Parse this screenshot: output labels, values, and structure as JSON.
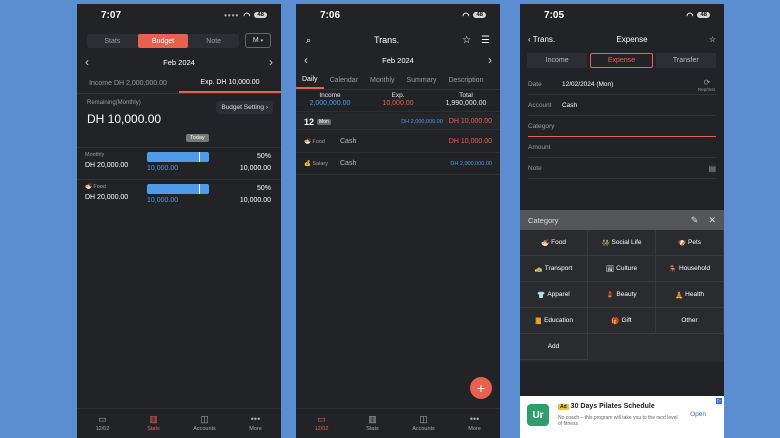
{
  "status": {
    "time_1": "7:07",
    "time_2": "7:06",
    "time_3": "7:05",
    "battery": "48"
  },
  "stats_screen": {
    "tabs": [
      "Stats",
      "Budget",
      "Note"
    ],
    "period_button": "M",
    "month": "Feb 2024",
    "income_tab": "Income DH 2,000,000.00",
    "expense_tab": "Exp. DH 10,000.00",
    "remaining_label": "Remaining(Monthly)",
    "remaining_amount": "DH 10,000.00",
    "budget_setting": "Budget Setting",
    "today_label": "Today",
    "budgets": [
      {
        "label": "Monthly",
        "amount": "DH 20,000.00",
        "percent": "50%",
        "percent_value": 0.5,
        "spent": "10,000.00",
        "total": "10,000.00"
      },
      {
        "label": "Food",
        "amount": "DH 20,000.00",
        "percent": "50%",
        "percent_value": 0.5,
        "spent": "10,000.00",
        "total": "10,000.00"
      }
    ],
    "nav": [
      {
        "label": "12/02",
        "icon": "calendar-icon"
      },
      {
        "label": "Stats",
        "icon": "stats-icon"
      },
      {
        "label": "Accounts",
        "icon": "accounts-icon"
      },
      {
        "label": "More",
        "icon": "more-icon"
      }
    ]
  },
  "trans_screen": {
    "title": "Trans.",
    "month": "Feb 2024",
    "tabs": [
      "Daily",
      "Calendar",
      "Monthly",
      "Summary",
      "Description"
    ],
    "income_label": "Income",
    "income_value": "2,000,000.00",
    "exp_label": "Exp.",
    "exp_value": "10,000.00",
    "total_label": "Total",
    "total_value": "1,990,000.00",
    "day": "12",
    "day_tag": "Mon",
    "day_income": "DH 2,000,000.00",
    "day_expense": "DH 10,000.00",
    "transactions": [
      {
        "category": "Food",
        "account": "Cash",
        "amount": "DH 10,000.00",
        "type": "expense"
      },
      {
        "category": "Salary",
        "account": "Cash",
        "amount": "DH 2,000,000.00",
        "type": "income"
      }
    ],
    "fab": "+",
    "nav": [
      {
        "label": "12/02",
        "icon": "calendar-icon"
      },
      {
        "label": "Stats",
        "icon": "stats-icon"
      },
      {
        "label": "Accounts",
        "icon": "accounts-icon"
      },
      {
        "label": "More",
        "icon": "more-icon"
      }
    ]
  },
  "expense_screen": {
    "back_label": "Trans.",
    "title": "Expense",
    "tabs": [
      "Income",
      "Expense",
      "Transfer"
    ],
    "repeat_label": "Rep/Inst.",
    "fields": [
      {
        "key": "Date",
        "value": "12/02/2024 (Mon)"
      },
      {
        "key": "Account",
        "value": "Cash"
      },
      {
        "key": "Category",
        "value": ""
      },
      {
        "key": "Amount",
        "value": ""
      },
      {
        "key": "Note",
        "value": ""
      }
    ],
    "category_title": "Category",
    "categories": [
      "Food",
      "Social Life",
      "Pets",
      "Transport",
      "Culture",
      "Household",
      "Apparel",
      "Beauty",
      "Health",
      "Education",
      "Gift",
      "Other",
      "Add"
    ],
    "category_emojis": [
      "🍜",
      "👫",
      "🐶",
      "🚕",
      "🖼",
      "🪑",
      "👕",
      "💄",
      "🧘",
      "📙",
      "🎁",
      "",
      ""
    ]
  },
  "ad": {
    "tag": "Ad",
    "title": "30 Days Pilates Schedule",
    "desc": "No coach – this program will take you to the next level of fitness",
    "open": "Open",
    "logo": "Ur"
  },
  "colors": {
    "accent": "#e8614f",
    "income": "#4e9bea",
    "background": "#5b8ed1",
    "panel": "#222327"
  }
}
